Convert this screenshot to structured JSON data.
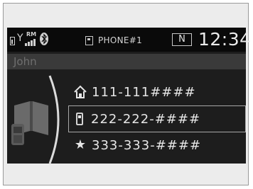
{
  "status_bar": {
    "roaming_label": "RM",
    "phone_name": "PHONE#1",
    "mode_badge": "N",
    "clock": "12:34"
  },
  "contact": {
    "name": "John"
  },
  "numbers": [
    {
      "type_icon": "home-icon",
      "number": "111-111####"
    },
    {
      "type_icon": "mobile-phone-icon",
      "number": "222-222-####",
      "selected": true
    },
    {
      "type_icon": "star-icon",
      "number": "333-333-####"
    }
  ],
  "colors": {
    "screen_bg": "#1d1d1d",
    "status_bg": "#0a0a0a",
    "text": "#e6e6e6",
    "dim_text": "#6f6f6f"
  }
}
